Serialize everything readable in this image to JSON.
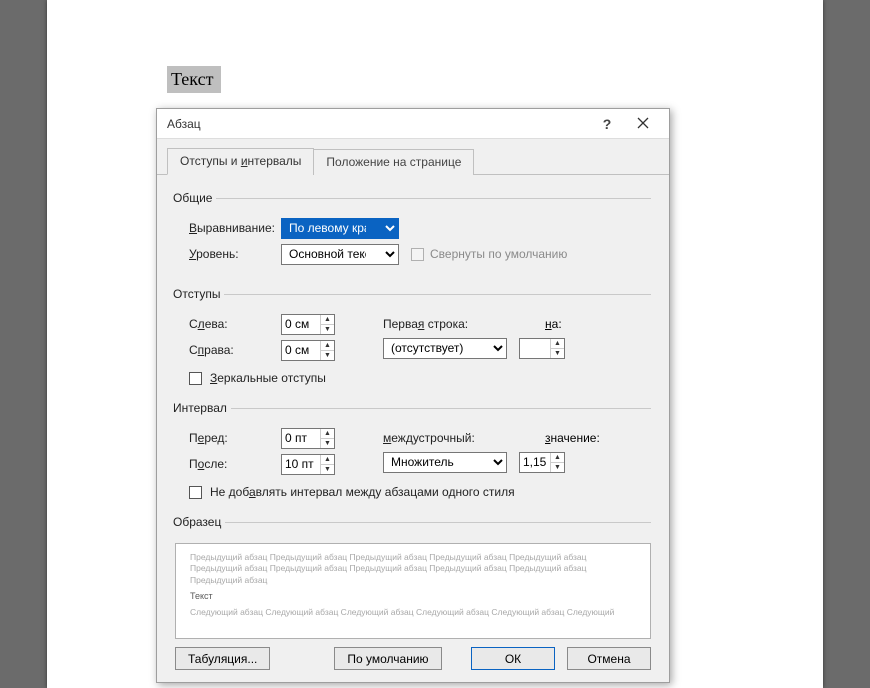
{
  "doc": {
    "selected_text": "Текст"
  },
  "dialog": {
    "title": "Абзац",
    "tabs": {
      "indents": "Отступы и интервалы",
      "position": "Положение на странице"
    },
    "groups": {
      "general": {
        "legend": "Общие",
        "alignment_label": "Выравнивание:",
        "alignment_value": "По левому краю",
        "outline_label": "Уровень:",
        "outline_value": "Основной текст",
        "collapsed_label": "Свернуты по умолчанию"
      },
      "indents": {
        "legend": "Отступы",
        "left_label": "Слева:",
        "left_value": "0 см",
        "right_label": "Справа:",
        "right_value": "0 см",
        "firstline_label": "Первая строка:",
        "firstline_value": "(отсутствует)",
        "by_label": "на:",
        "by_value": "",
        "mirror_label": "Зеркальные отступы"
      },
      "spacing": {
        "legend": "Интервал",
        "before_label": "Перед:",
        "before_value": "0 пт",
        "after_label": "После:",
        "after_value": "10 пт",
        "linespace_label": "междустрочный:",
        "linespace_value": "Множитель",
        "at_label": "значение:",
        "at_value": "1,15",
        "nosame_label": "Не добавлять интервал между абзацами одного стиля"
      },
      "preview": {
        "legend": "Образец",
        "prev_para": "Предыдущий абзац Предыдущий абзац Предыдущий абзац Предыдущий абзац Предыдущий абзац Предыдущий абзац Предыдущий абзац Предыдущий абзац Предыдущий абзац Предыдущий абзац Предыдущий абзац",
        "sample": "Текст",
        "next_para": "Следующий абзац Следующий абзац Следующий абзац Следующий абзац Следующий абзац Следующий"
      }
    },
    "buttons": {
      "tabs": "Табуляция...",
      "default": "По умолчанию",
      "ok": "ОК",
      "cancel": "Отмена"
    }
  }
}
